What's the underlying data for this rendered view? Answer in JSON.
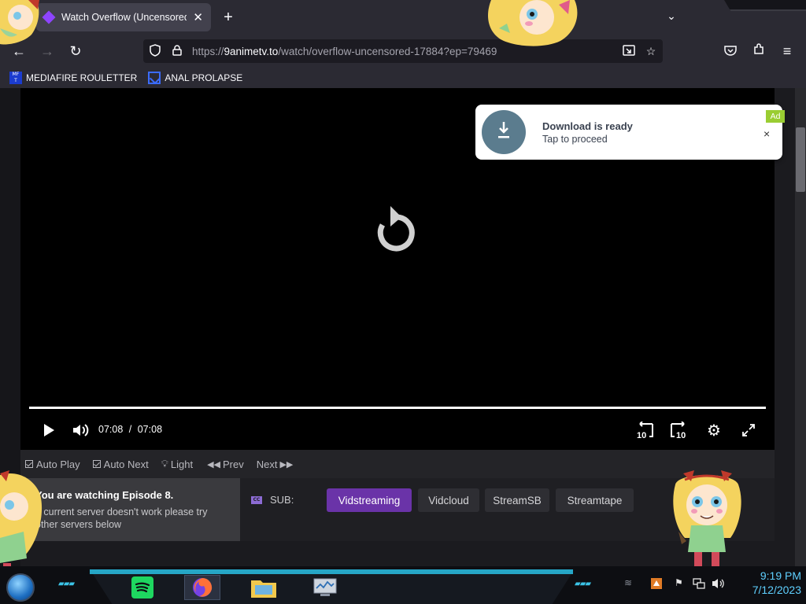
{
  "browser": {
    "tab_title": "Watch Overflow (Uncensored) o",
    "url_prefix": "https://",
    "url_host": "9animetv.to",
    "url_path": "/watch/overflow-uncensored-17884?ep=79469"
  },
  "bookmarks": [
    {
      "label": "MEDIAFIRE ROULETTER",
      "icon": "mediafire-icon"
    },
    {
      "label": "ANAL PROLAPSE",
      "icon": "bookmark-icon"
    }
  ],
  "player": {
    "current_time": "07:08",
    "separator": "/",
    "duration": "07:08",
    "progress": 1.0,
    "rewind_label": "10",
    "forward_label": "10"
  },
  "ad": {
    "title": "Download is ready",
    "subtitle": "Tap to proceed",
    "badge": "Ad",
    "close": "×"
  },
  "options": {
    "auto_play": "Auto Play",
    "auto_next": "Auto Next",
    "light": "Light",
    "prev": "Prev",
    "next": "Next"
  },
  "servers": {
    "notice_title": "You are watching Episode 8.",
    "notice_body": "If current server doesn't work please try other servers below",
    "sub_label": "SUB:",
    "cc_badge": "CC",
    "list": [
      "Vidstreaming",
      "Vidcloud",
      "StreamSB",
      "Streamtape"
    ],
    "active": "Vidstreaming"
  },
  "taskbar": {
    "time": "9:19 PM",
    "date": "7/12/2023"
  },
  "colors": {
    "accent": "#6a33a8",
    "ad_icon": "#5b7c8e",
    "clock": "#5fd0ff"
  }
}
